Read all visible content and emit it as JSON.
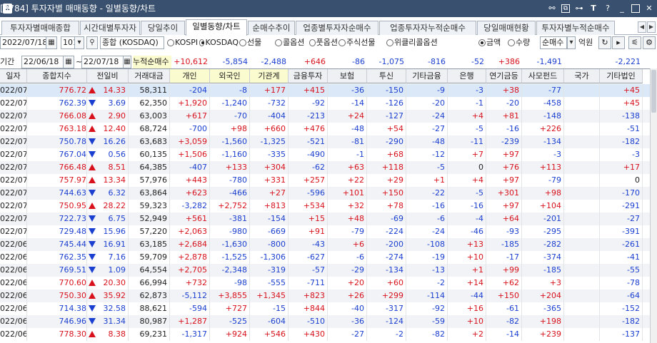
{
  "window": {
    "num": "1",
    "title": "[0784]  투자자별 매매동향 - 일별동향/차트",
    "icons": [
      "window-num-icon",
      "link-icon",
      "copy-icon",
      "pin-icon",
      "text-size-icon",
      "help-icon",
      "minimize-icon",
      "maximize-icon",
      "close-icon"
    ]
  },
  "tabs": [
    "투자자별매매종합",
    "시간대별투자자",
    "당일추이",
    "일별동향/차트",
    "순매수추이",
    "업종별투자자순매수",
    "업종투자자누적순매수",
    "당일매매현황",
    "투자자별누적순매수"
  ],
  "active_tab": 3,
  "toolbar": {
    "date": "2022/07/18",
    "code": "101",
    "market": "종합 (KOSDAQ)",
    "radios": [
      {
        "label": "KOSPI",
        "on": false
      },
      {
        "label": "KOSDAQ",
        "on": true
      },
      {
        "label": "선물",
        "on": false
      },
      {
        "label": "콜옵션",
        "on": false
      },
      {
        "label": "풋옵션",
        "on": false
      },
      {
        "label": "주식선물",
        "on": false
      },
      {
        "label": "위클리콜옵션",
        "on": false
      }
    ],
    "amount_radios": [
      {
        "label": "금액",
        "on": true
      },
      {
        "label": "수량",
        "on": false
      }
    ],
    "select": "순매수",
    "unit": "억원"
  },
  "range": {
    "label": "기간",
    "from": "22/06/18",
    "to": "22/07/18",
    "cum_label": "누적순매수"
  },
  "summary": [
    "+10,612",
    "-5,854",
    "-2,488",
    "+646",
    "-86",
    "-1,075",
    "-816",
    "-52",
    "+386",
    "-1,491",
    "",
    "-2,221"
  ],
  "headers": [
    "일자",
    "종합지수",
    "전일비",
    "거래대금",
    "개인",
    "외국인",
    "기관계",
    "금융투자",
    "보험",
    "투신",
    "기타금융",
    "은행",
    "연기금등",
    "사모펀드",
    "국가",
    "기타법인"
  ],
  "rows": [
    [
      "022/07/18",
      "776.72",
      "up",
      "14.33",
      "58,311",
      "-204",
      "-8",
      "+177",
      "+415",
      "-36",
      "-150",
      "-9",
      "-3",
      "+38",
      "-77",
      "",
      "+45"
    ],
    [
      "022/07/15",
      "762.39",
      "dn",
      "3.69",
      "62,350",
      "+1,920",
      "-1,240",
      "-732",
      "-92",
      "-14",
      "-126",
      "-20",
      "-1",
      "-20",
      "-458",
      "",
      "+45"
    ],
    [
      "022/07/14",
      "766.08",
      "up",
      "2.90",
      "63,003",
      "+617",
      "-70",
      "-404",
      "-213",
      "+24",
      "-127",
      "-24",
      "+4",
      "+81",
      "-148",
      "",
      "-138"
    ],
    [
      "022/07/13",
      "763.18",
      "up",
      "12.40",
      "68,724",
      "-700",
      "+98",
      "+660",
      "+476",
      "-48",
      "+54",
      "-27",
      "-5",
      "-16",
      "+226",
      "",
      "-51"
    ],
    [
      "022/07/12",
      "750.78",
      "dn",
      "16.26",
      "63,683",
      "+3,059",
      "-1,560",
      "-1,325",
      "-521",
      "-81",
      "-290",
      "-48",
      "-11",
      "-239",
      "-134",
      "",
      "-182"
    ],
    [
      "022/07/11",
      "767.04",
      "dn",
      "0.56",
      "60,135",
      "+1,506",
      "-1,160",
      "-335",
      "-490",
      "-1",
      "+68",
      "-12",
      "+7",
      "+97",
      "-3",
      "",
      "-3"
    ],
    [
      "022/07/08",
      "766.48",
      "up",
      "8.51",
      "64,385",
      "-407",
      "+133",
      "+304",
      "-62",
      "+63",
      "+118",
      "-5",
      "0",
      "+76",
      "+113",
      "",
      "+17"
    ],
    [
      "022/07/07",
      "757.97",
      "up",
      "13.34",
      "57,976",
      "+443",
      "-780",
      "+331",
      "+257",
      "+22",
      "+29",
      "+1",
      "+4",
      "+97",
      "-79",
      "",
      "0"
    ],
    [
      "022/07/06",
      "744.63",
      "dn",
      "6.32",
      "63,864",
      "+623",
      "-466",
      "+27",
      "-596",
      "+101",
      "+150",
      "-22",
      "-5",
      "+301",
      "+98",
      "",
      "-170"
    ],
    [
      "022/07/05",
      "750.95",
      "up",
      "28.22",
      "59,323",
      "-3,282",
      "+2,752",
      "+813",
      "+534",
      "+32",
      "+78",
      "-16",
      "-16",
      "+97",
      "+104",
      "",
      "-291"
    ],
    [
      "022/07/04",
      "722.73",
      "dn",
      "6.75",
      "52,949",
      "+561",
      "-381",
      "-154",
      "+15",
      "+48",
      "-69",
      "-6",
      "-4",
      "+64",
      "-201",
      "",
      "-27"
    ],
    [
      "022/07/01",
      "729.48",
      "dn",
      "15.96",
      "57,220",
      "+2,063",
      "-980",
      "-669",
      "+91",
      "-79",
      "-224",
      "-24",
      "-46",
      "-93",
      "-295",
      "",
      "-391"
    ],
    [
      "022/06/30",
      "745.44",
      "dn",
      "16.91",
      "63,185",
      "+2,684",
      "-1,630",
      "-800",
      "-43",
      "+6",
      "-200",
      "-108",
      "+13",
      "-185",
      "-282",
      "",
      "-261"
    ],
    [
      "022/06/29",
      "762.35",
      "dn",
      "7.16",
      "59,709",
      "+2,878",
      "-1,525",
      "-1,306",
      "-627",
      "-6",
      "-274",
      "-19",
      "+10",
      "-17",
      "-374",
      "",
      "-41"
    ],
    [
      "022/06/28",
      "769.51",
      "dn",
      "1.09",
      "64,554",
      "+2,705",
      "-2,348",
      "-319",
      "-57",
      "-29",
      "-134",
      "-13",
      "+1",
      "+99",
      "-185",
      "",
      "-55"
    ],
    [
      "022/06/27",
      "770.60",
      "up",
      "20.30",
      "66,994",
      "+732",
      "-98",
      "-555",
      "-711",
      "+20",
      "+60",
      "-2",
      "+14",
      "+62",
      "+3",
      "",
      "-78"
    ],
    [
      "022/06/24",
      "750.30",
      "up",
      "35.92",
      "62,873",
      "-5,112",
      "+3,855",
      "+1,345",
      "+823",
      "+26",
      "+299",
      "-114",
      "-44",
      "+150",
      "+204",
      "",
      "-64"
    ],
    [
      "022/06/23",
      "714.38",
      "dn",
      "32.58",
      "88,621",
      "-594",
      "+727",
      "-15",
      "+844",
      "-40",
      "-317",
      "-92",
      "+16",
      "-61",
      "-365",
      "",
      "-152"
    ],
    [
      "022/06/22",
      "746.96",
      "dn",
      "31.34",
      "80,987",
      "+1,287",
      "-525",
      "-604",
      "-510",
      "-36",
      "-124",
      "-59",
      "+10",
      "-82",
      "+198",
      "",
      "-182"
    ],
    [
      "022/06/21",
      "778.30",
      "up",
      "8.38",
      "69,231",
      "-1,317",
      "+924",
      "+546",
      "+430",
      "-27",
      "-2",
      "-82",
      "+2",
      "-14",
      "+239",
      "",
      "-137"
    ]
  ],
  "colors": {
    "up": "#d8121d",
    "down": "#1b3fd0",
    "selected_row": "#dbe8f8",
    "alt_row": "#f1f3f6",
    "titlebar": "#39506e"
  }
}
